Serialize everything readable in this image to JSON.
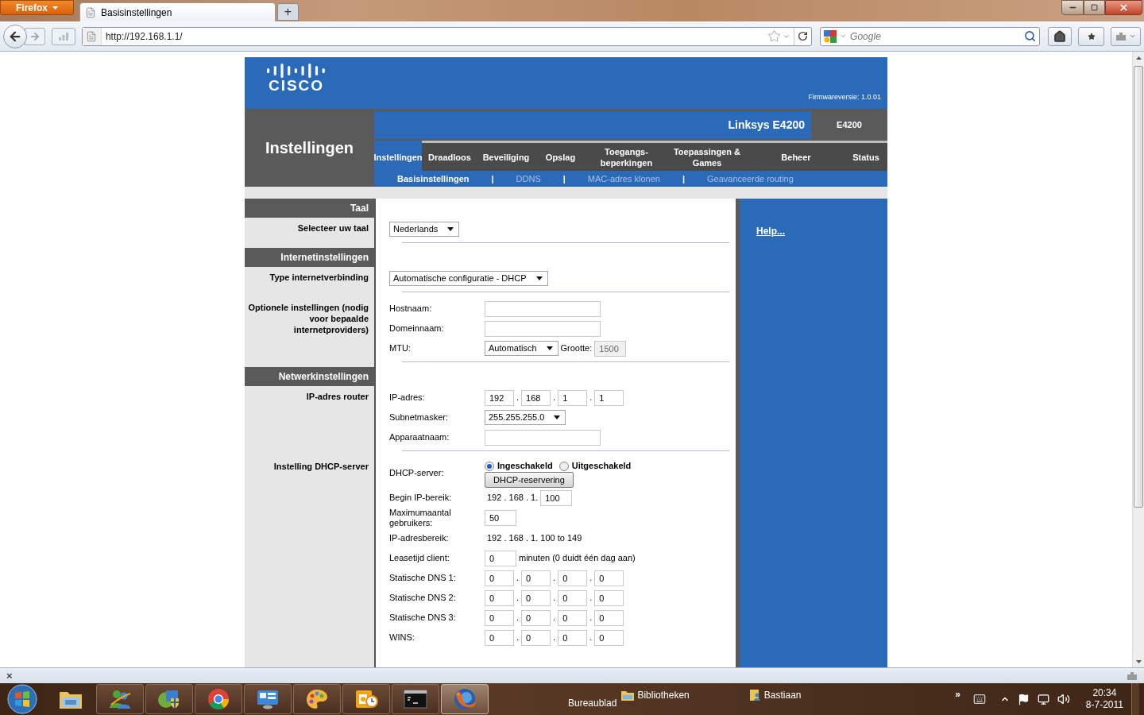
{
  "browser": {
    "menu_button": "Firefox",
    "tabs": [
      {
        "label": "Basisinstellingen",
        "selected": true
      }
    ],
    "new_tab": "+",
    "url": "http://192.168.1.1/",
    "search_placeholder": "Google"
  },
  "router": {
    "logo": "CISCO",
    "firmware": "Firmwareversie: 1.0.01",
    "page_title": "Instellingen",
    "product": "Linksys E4200",
    "model": "E4200",
    "tabs": [
      {
        "label": "Instellingen",
        "selected": true
      },
      {
        "label": "Draadloos",
        "selected": false
      },
      {
        "label": "Beveiliging",
        "selected": false
      },
      {
        "label": "Opslag",
        "selected": false
      },
      {
        "label": "Toegangs-beperkingen",
        "selected": false
      },
      {
        "label": "Toepassingen & Games",
        "selected": false
      },
      {
        "label": "Beheer",
        "selected": false
      },
      {
        "label": "Status",
        "selected": false
      }
    ],
    "subtab_separator": "|",
    "subtabs": [
      {
        "label": "Basisinstellingen",
        "selected": true
      },
      {
        "label": "DDNS",
        "selected": false
      },
      {
        "label": "MAC-adres klonen",
        "selected": false
      },
      {
        "label": "Geavanceerde routing",
        "selected": false
      }
    ],
    "help_link": "Help...",
    "sections": [
      {
        "title": "Taal",
        "blocks": [
          {
            "label": "Selecteer uw taal",
            "fields": [
              {
                "controls": [
                  {
                    "kind": "select",
                    "value": "Nederlands"
                  }
                ]
              }
            ]
          }
        ]
      },
      {
        "title": "Internetinstellingen",
        "blocks": [
          {
            "label": "Type internetverbinding",
            "fields": [
              {
                "controls": [
                  {
                    "kind": "select",
                    "value": "Automatische configuratie - DHCP"
                  }
                ]
              }
            ]
          },
          {
            "label": "Optionele instellingen (nodig voor bepaalde internetproviders)",
            "fields": [
              {
                "label": "Hostnaam:",
                "controls": [
                  {
                    "kind": "input"
                  }
                ]
              },
              {
                "label": "Domeinnaam:",
                "controls": [
                  {
                    "kind": "input"
                  }
                ]
              },
              {
                "label": "MTU:",
                "controls": [
                  {
                    "kind": "select",
                    "value": "Automatisch"
                  },
                  {
                    "kind": "text",
                    "text": "Grootte:"
                  },
                  {
                    "kind": "input",
                    "value": "1500",
                    "disabled": true
                  }
                ]
              }
            ]
          }
        ]
      },
      {
        "title": "Netwerkinstellingen",
        "blocks": [
          {
            "label": "IP-adres router",
            "fields": [
              {
                "label": "IP-adres:",
                "controls": [
                  {
                    "kind": "ip",
                    "separator": ".",
                    "parts": [
                      "192",
                      "168",
                      "1",
                      "1"
                    ]
                  }
                ]
              },
              {
                "label": "Subnetmasker:",
                "controls": [
                  {
                    "kind": "select",
                    "value": "255.255.255.0"
                  }
                ]
              },
              {
                "label": "Apparaatnaam:",
                "controls": [
                  {
                    "kind": "input"
                  }
                ]
              }
            ]
          },
          {
            "label": "Instelling DHCP-server",
            "fields": [
              {
                "label": "DHCP-server:",
                "controls": [
                  {
                    "kind": "radio",
                    "label": "Ingeschakeld",
                    "selected": true
                  },
                  {
                    "kind": "radio",
                    "label": "Uitgeschakeld",
                    "selected": false
                  },
                  {
                    "kind": "button",
                    "label": "DHCP-reservering"
                  }
                ]
              },
              {
                "label": "Begin IP-bereik:",
                "controls": [
                  {
                    "kind": "text",
                    "text": "192 . 168 . 1."
                  },
                  {
                    "kind": "input",
                    "value": "100"
                  }
                ]
              },
              {
                "label": "Maximumaantal gebruikers:",
                "controls": [
                  {
                    "kind": "input",
                    "value": "50"
                  }
                ]
              },
              {
                "label": "IP-adresbereik:",
                "controls": [
                  {
                    "kind": "text",
                    "text": "192 . 168 . 1. 100 to 149"
                  }
                ]
              },
              {
                "label": "Leasetijd client:",
                "controls": [
                  {
                    "kind": "input",
                    "value": "0"
                  },
                  {
                    "kind": "text",
                    "text": "minuten (0 duidt één dag aan)"
                  }
                ]
              },
              {
                "label": "Statische DNS 1:",
                "controls": [
                  {
                    "kind": "ip",
                    "separator": ".",
                    "parts": [
                      "0",
                      "0",
                      "0",
                      "0"
                    ]
                  }
                ]
              },
              {
                "label": "Statische DNS 2:",
                "controls": [
                  {
                    "kind": "ip",
                    "separator": ".",
                    "parts": [
                      "0",
                      "0",
                      "0",
                      "0"
                    ]
                  }
                ]
              },
              {
                "label": "Statische DNS 3:",
                "controls": [
                  {
                    "kind": "ip",
                    "separator": ".",
                    "parts": [
                      "0",
                      "0",
                      "0",
                      "0"
                    ]
                  }
                ]
              },
              {
                "label": "WINS:",
                "controls": [
                  {
                    "kind": "ip",
                    "separator": ".",
                    "parts": [
                      "0",
                      "0",
                      "0",
                      "0"
                    ]
                  }
                ]
              }
            ]
          }
        ]
      }
    ]
  },
  "addon_bar": {
    "close": "×"
  },
  "taskbar": {
    "apps": [
      {
        "kind": "folder",
        "selected": false
      },
      {
        "kind": "people",
        "selected": false
      },
      {
        "kind": "shield",
        "selected": false
      },
      {
        "kind": "wheel",
        "selected": false
      },
      {
        "kind": "panel",
        "selected": false
      },
      {
        "kind": "palette",
        "selected": false
      },
      {
        "kind": "mail",
        "selected": false
      },
      {
        "kind": "terminal",
        "selected": false
      },
      {
        "kind": "globe",
        "selected": true
      }
    ],
    "toolbars": [
      {
        "kind": "plain",
        "label": "Bureaublad"
      },
      {
        "kind": "folder",
        "label": "Bibliotheken"
      },
      {
        "kind": "user",
        "label": "Bastiaan"
      }
    ],
    "overflow": "»",
    "time": "20:34",
    "date": "8-7-2011"
  }
}
